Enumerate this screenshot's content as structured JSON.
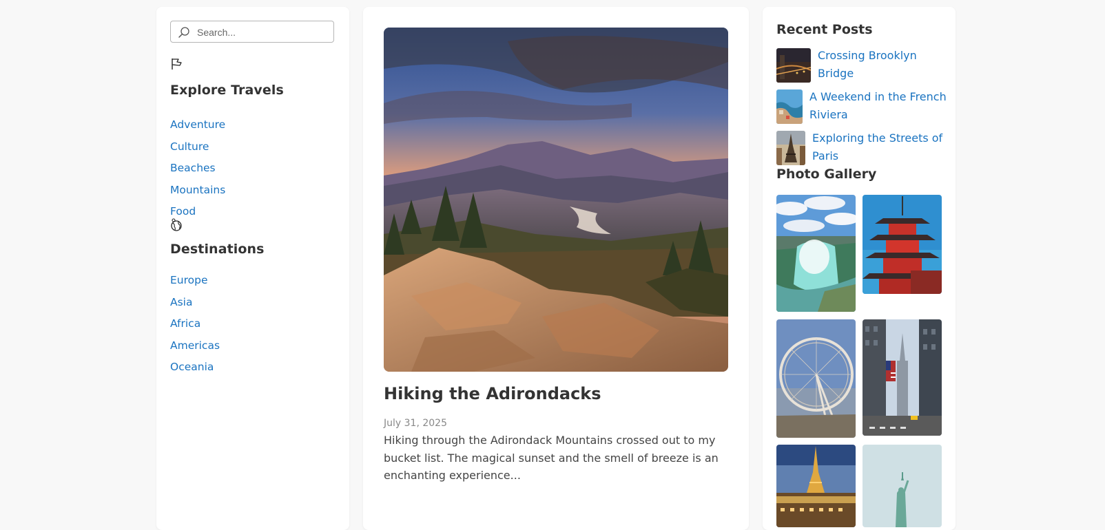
{
  "search": {
    "placeholder": "Search..."
  },
  "sidebar": {
    "explore_heading": "Explore Travels",
    "explore_items": [
      "Adventure",
      "Culture",
      "Beaches",
      "Mountains",
      "Food"
    ],
    "destinations_heading": "Destinations",
    "destination_items": [
      "Europe",
      "Asia",
      "Africa",
      "Americas",
      "Oceania"
    ]
  },
  "post": {
    "title": "Hiking the Adirondacks",
    "date": "July 31, 2025",
    "excerpt": "Hiking through the Adirondack Mountains crossed out to my bucket list. The magical sunset and the smell of breeze is an enchanting experience..."
  },
  "recent": {
    "heading": "Recent Posts",
    "items": [
      {
        "title": "Crossing Brooklyn Bridge"
      },
      {
        "title": "A Weekend in the French Riviera"
      },
      {
        "title": "Exploring the Streets of Paris"
      }
    ]
  },
  "gallery": {
    "heading": "Photo Gallery"
  },
  "colors": {
    "link": "#1a73c0",
    "text": "#333333",
    "background": "#f8f8f8"
  },
  "icons": [
    "search-icon",
    "flag-icon",
    "globe-icon"
  ]
}
